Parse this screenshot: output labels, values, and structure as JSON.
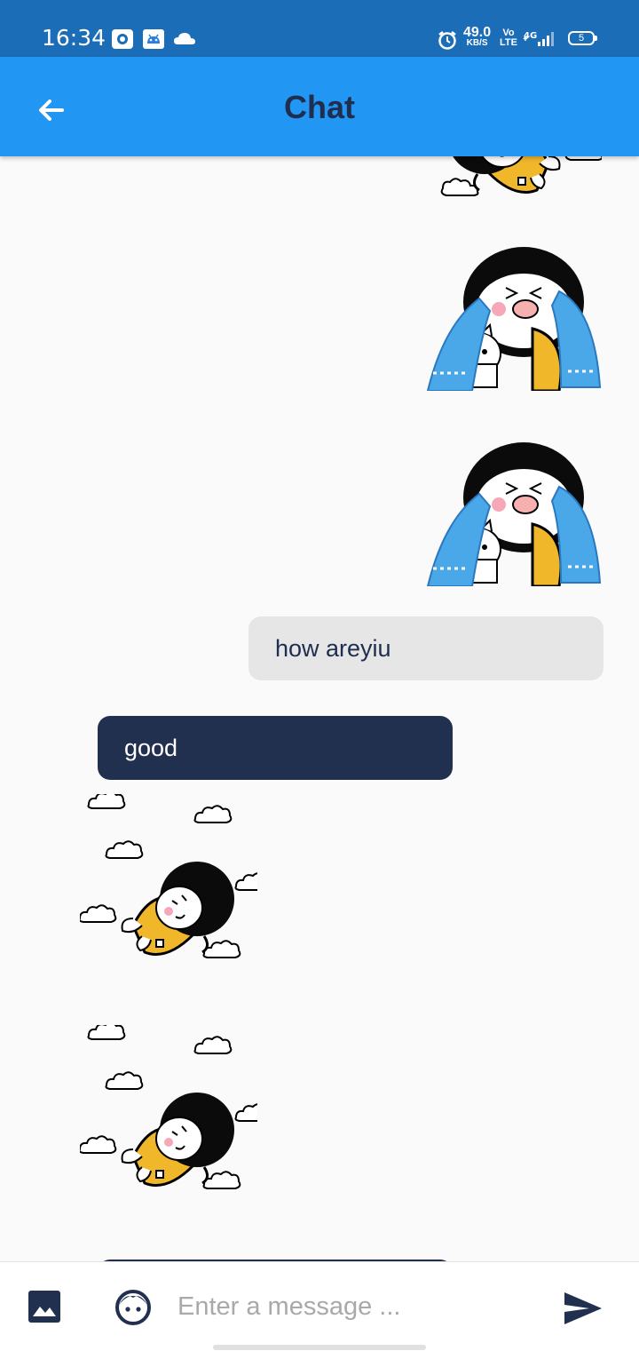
{
  "status_bar": {
    "time": "16:34",
    "net_speed_value": "49.0",
    "net_speed_unit": "KB/S",
    "volte_top": "Vo",
    "volte_bottom": "LTE",
    "network_type": "4G",
    "battery_level": "5"
  },
  "header": {
    "title": "Chat",
    "back_icon": "arrow-back-icon"
  },
  "messages": [
    {
      "type": "sticker",
      "direction": "sent",
      "sticker": "flying-girl-clouds-sticker"
    },
    {
      "type": "sticker",
      "direction": "sent",
      "sticker": "crying-girl-with-cat-sticker"
    },
    {
      "type": "sticker",
      "direction": "sent",
      "sticker": "crying-girl-with-cat-sticker"
    },
    {
      "type": "text",
      "direction": "sent",
      "text": "how areyiu"
    },
    {
      "type": "text",
      "direction": "received",
      "text": "good"
    },
    {
      "type": "sticker",
      "direction": "received",
      "sticker": "flying-girl-clouds-sticker"
    },
    {
      "type": "sticker",
      "direction": "received",
      "sticker": "flying-girl-clouds-sticker"
    },
    {
      "type": "text",
      "direction": "received",
      "text": ""
    }
  ],
  "composer": {
    "image_icon": "image-icon",
    "emoji_icon": "emoji-face-icon",
    "placeholder": "Enter a message ...",
    "value": "",
    "send_icon": "send-icon"
  },
  "colors": {
    "status_bar": "#1c6db8",
    "app_bar": "#2196f3",
    "title": "#1f2d4e",
    "sent_bubble": "#e6e6e6",
    "received_bubble": "#21304f",
    "background": "#fafafa"
  }
}
